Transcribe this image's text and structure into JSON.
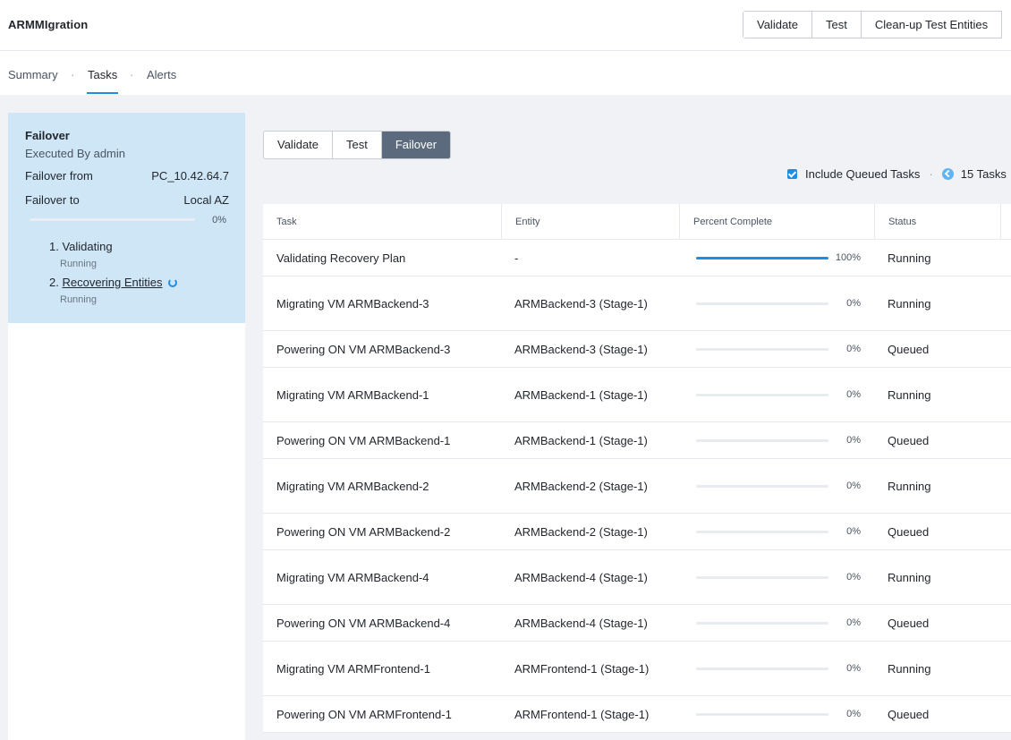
{
  "app": {
    "title": "ARMMIgration"
  },
  "header_actions": [
    {
      "label": "Validate"
    },
    {
      "label": "Test"
    },
    {
      "label": "Clean-up Test Entities"
    }
  ],
  "tabs": [
    {
      "label": "Summary"
    },
    {
      "label": "Tasks"
    },
    {
      "label": "Alerts"
    }
  ],
  "tab_separator": "·",
  "summary": {
    "title": "Failover",
    "executed_by": "Executed By admin",
    "from_label": "Failover from",
    "from_value": "PC_10.42.64.7",
    "to_label": "Failover to",
    "to_value": "Local AZ",
    "progress_pct": 0,
    "progress_text": "0%",
    "steps": [
      {
        "label": "1. Validating",
        "status": "Running"
      },
      {
        "label": "2.",
        "link": "Recovering Entities",
        "status": "Running"
      }
    ]
  },
  "segment": {
    "options": [
      {
        "label": "Validate"
      },
      {
        "label": "Test"
      },
      {
        "label": "Failover"
      }
    ],
    "selected": "Failover"
  },
  "queued": {
    "label": "Include Queued Tasks",
    "checked": true,
    "separator": "·",
    "count_text": "15 Tasks"
  },
  "table": {
    "columns": [
      "Task",
      "Entity",
      "Percent Complete",
      "Status"
    ],
    "rows": [
      {
        "task": "Validating Recovery Plan",
        "entity": "-",
        "percent": 100,
        "percent_text": "100%",
        "status": "Running"
      },
      {
        "task": "Migrating VM ARMBackend-3",
        "entity": "ARMBackend-3 (Stage-1)",
        "percent": 0,
        "percent_text": "0%",
        "status": "Running"
      },
      {
        "task": "Powering ON VM ARMBackend-3",
        "entity": "ARMBackend-3 (Stage-1)",
        "percent": 0,
        "percent_text": "0%",
        "status": "Queued"
      },
      {
        "task": "Migrating VM ARMBackend-1",
        "entity": "ARMBackend-1 (Stage-1)",
        "percent": 0,
        "percent_text": "0%",
        "status": "Running"
      },
      {
        "task": "Powering ON VM ARMBackend-1",
        "entity": "ARMBackend-1 (Stage-1)",
        "percent": 0,
        "percent_text": "0%",
        "status": "Queued"
      },
      {
        "task": "Migrating VM ARMBackend-2",
        "entity": "ARMBackend-2 (Stage-1)",
        "percent": 0,
        "percent_text": "0%",
        "status": "Running"
      },
      {
        "task": "Powering ON VM ARMBackend-2",
        "entity": "ARMBackend-2 (Stage-1)",
        "percent": 0,
        "percent_text": "0%",
        "status": "Queued"
      },
      {
        "task": "Migrating VM ARMBackend-4",
        "entity": "ARMBackend-4 (Stage-1)",
        "percent": 0,
        "percent_text": "0%",
        "status": "Running"
      },
      {
        "task": "Powering ON VM ARMBackend-4",
        "entity": "ARMBackend-4 (Stage-1)",
        "percent": 0,
        "percent_text": "0%",
        "status": "Queued"
      },
      {
        "task": "Migrating VM ARMFrontend-1",
        "entity": "ARMFrontend-1 (Stage-1)",
        "percent": 0,
        "percent_text": "0%",
        "status": "Running"
      },
      {
        "task": "Powering ON VM ARMFrontend-1",
        "entity": "ARMFrontend-1 (Stage-1)",
        "percent": 0,
        "percent_text": "0%",
        "status": "Queued"
      }
    ]
  },
  "colors": {
    "accent": "#1b8fe6",
    "summary_bg": "#cfe6f7",
    "selected_segment": "#5b6b7d"
  }
}
